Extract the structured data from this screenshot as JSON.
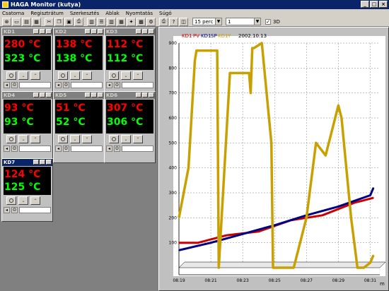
{
  "window": {
    "title": "HAGA Monitor (kutya)"
  },
  "menu": [
    "Csatorna",
    "Regisztrátum",
    "Szerkesztés",
    "Ablak",
    "Nyomtatás",
    "Súgó"
  ],
  "toolbar": {
    "interval": "15 perc",
    "channel": "1",
    "threed_label": "3D",
    "threed_checked": "✓"
  },
  "controllers": [
    {
      "name": "KD1",
      "pv": "280 °C",
      "sp": "323 °C"
    },
    {
      "name": "KD2",
      "pv": "138 °C",
      "sp": "138 °C"
    },
    {
      "name": "KD3",
      "pv": "112 °C",
      "sp": "112 °C"
    },
    {
      "name": "KD4",
      "pv": "93 °C",
      "sp": "93 °C"
    },
    {
      "name": "KD5",
      "pv": "51 °C",
      "sp": "52 °C"
    },
    {
      "name": "KD6",
      "pv": "307 °C",
      "sp": "306 °C"
    },
    {
      "name": "KD7",
      "pv": "124 °C",
      "sp": "125 °C"
    }
  ],
  "chart": {
    "legend_kd1": "KD1",
    "legend_pv": "PV",
    "legend_kd1b": "KD1",
    "legend_sp": "SP",
    "legend_kd1c": "KD1",
    "legend_y": "Y",
    "date": "2002.10.13",
    "x_unit": "m",
    "colors": {
      "pv": "#cc0000",
      "sp": "#000080",
      "y": "#c8a000",
      "grid": "#808080",
      "bg": "#ffffff"
    }
  },
  "chart_data": {
    "type": "line",
    "ylim": [
      0,
      900
    ],
    "yticks": [
      100,
      200,
      300,
      400,
      500,
      600,
      700,
      800,
      900
    ],
    "xticks": [
      "08:19",
      "08:21",
      "08:23",
      "08:25",
      "08:27",
      "08:29",
      "08:31"
    ],
    "series": [
      {
        "name": "PV",
        "x": [
          0,
          0.6,
          1.5,
          2.5,
          3.5,
          4.5,
          5.5,
          6.1
        ],
        "values": [
          100,
          100,
          130,
          145,
          190,
          210,
          260,
          280
        ]
      },
      {
        "name": "SP",
        "x": [
          0,
          1,
          2,
          3,
          4,
          5,
          6,
          6.1
        ],
        "values": [
          70,
          100,
          135,
          170,
          210,
          245,
          290,
          320
        ]
      },
      {
        "name": "Y",
        "x": [
          0,
          0.3,
          0.5,
          0.55,
          1.2,
          1.25,
          1.6,
          2.2,
          2.25,
          2.3,
          2.35,
          2.6,
          2.9,
          2.95,
          3.6,
          4.0,
          4.3,
          4.6,
          5.0,
          5.1,
          5.4,
          5.6,
          5.8,
          6.0,
          6.1
        ],
        "values": [
          200,
          400,
          830,
          870,
          870,
          0,
          780,
          780,
          700,
          880,
          880,
          900,
          500,
          0,
          0,
          200,
          500,
          450,
          650,
          600,
          200,
          0,
          0,
          20,
          50
        ]
      }
    ]
  }
}
